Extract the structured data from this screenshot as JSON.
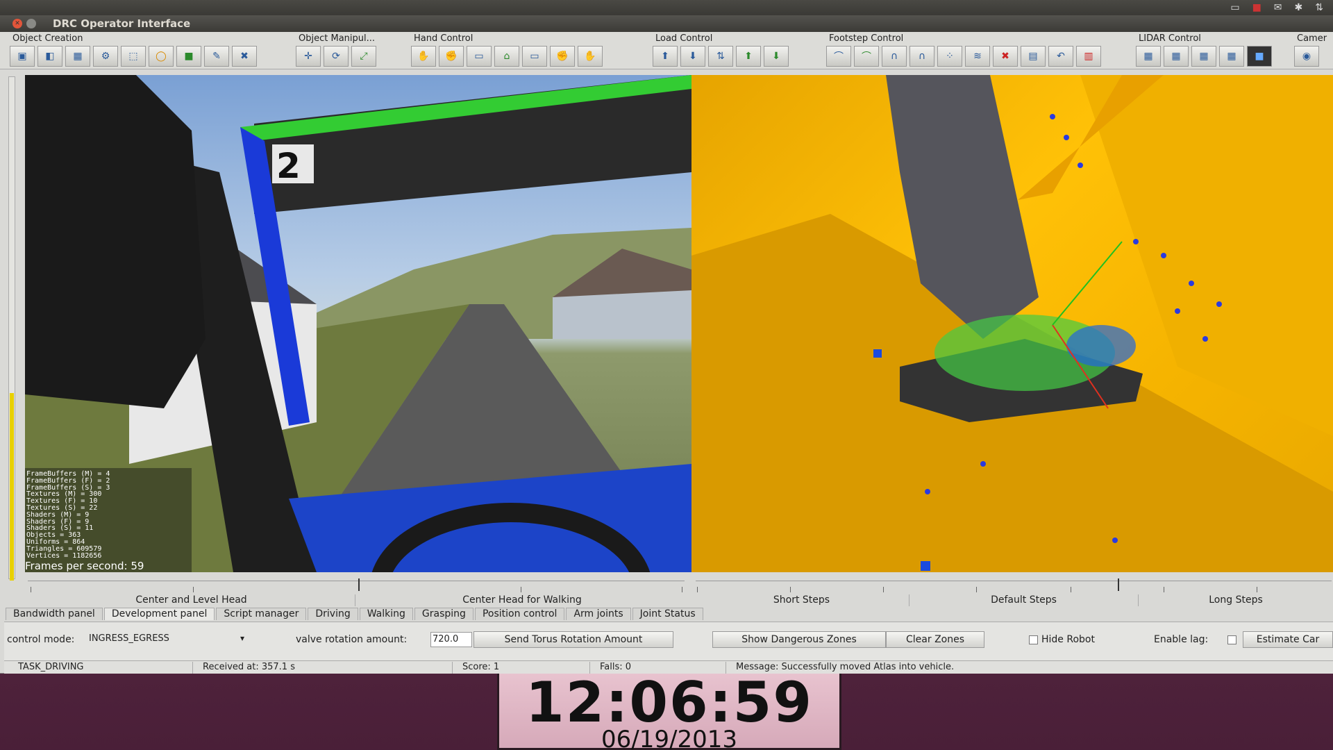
{
  "window": {
    "title": "DRC Operator Interface"
  },
  "toolbar": {
    "groups": [
      {
        "label": "Object Creation",
        "icons": [
          "▣",
          "◧",
          "▦",
          "⚙",
          "⬚",
          "◯",
          "■",
          "✎",
          "✖"
        ]
      },
      {
        "label": "Object Manipul...",
        "icons": [
          "✛",
          "⟳",
          "⤢"
        ]
      },
      {
        "label": "Hand Control",
        "icons": [
          "✋",
          "✊",
          "▭",
          "⌂",
          "▭",
          "✊",
          "✋"
        ]
      },
      {
        "label": "Load Control",
        "icons": [
          "⬆",
          "⬇",
          "⇅",
          "⬆",
          "⬇"
        ]
      },
      {
        "label": "Footstep Control",
        "icons": [
          "⌒",
          "⌒",
          "∩",
          "∩",
          "⁘",
          "≋",
          "✖",
          "▤",
          "↶",
          "▥"
        ]
      },
      {
        "label": "LIDAR Control",
        "icons": [
          "▦",
          "▦",
          "▦",
          "▦",
          "■"
        ]
      },
      {
        "label": "Camer",
        "icons": [
          "◉"
        ]
      }
    ]
  },
  "stats": {
    "lines": [
      "FrameBuffers (M) = 4",
      "FrameBuffers (F) = 2",
      "FrameBuffers (S) = 3",
      "Textures (M) = 300",
      "Textures (F) = 10",
      "Textures (S) = 22",
      "Shaders (M) = 9",
      "Shaders (F) = 9",
      "Shaders (S) = 11",
      "Objects = 363",
      "Uniforms = 864",
      "Triangles = 609579",
      "Vertices = 1182656"
    ],
    "fps": "Frames per second: 59"
  },
  "presets": {
    "head": [
      "Center and Level Head",
      "Center Head for Walking"
    ],
    "steps": [
      "Short Steps",
      "Default Steps",
      "Long Steps"
    ]
  },
  "tabs": [
    "Bandwidth panel",
    "Development panel",
    "Script manager",
    "Driving",
    "Walking",
    "Grasping",
    "Position control",
    "Arm joints",
    "Joint Status"
  ],
  "controls": {
    "control_mode_label": "control mode:",
    "control_mode_value": "INGRESS_EGRESS",
    "valve_label": "valve rotation amount:",
    "valve_value": "720.0",
    "send_torus": "Send Torus Rotation Amount",
    "show_zones": "Show Dangerous Zones",
    "clear_zones": "Clear Zones",
    "hide_robot": "Hide Robot",
    "enable_lag": "Enable lag:",
    "estimate_car": "Estimate Car"
  },
  "status": {
    "task": "TASK_DRIVING",
    "received": "Received at:  357.1 s",
    "score": "Score:  1",
    "falls": "Falls:  0",
    "message": "Message:  Successfully moved Atlas into vehicle."
  },
  "clock": {
    "time": "12:06:59",
    "date": "06/19/2013"
  },
  "scene": {
    "sign_number": "2"
  }
}
